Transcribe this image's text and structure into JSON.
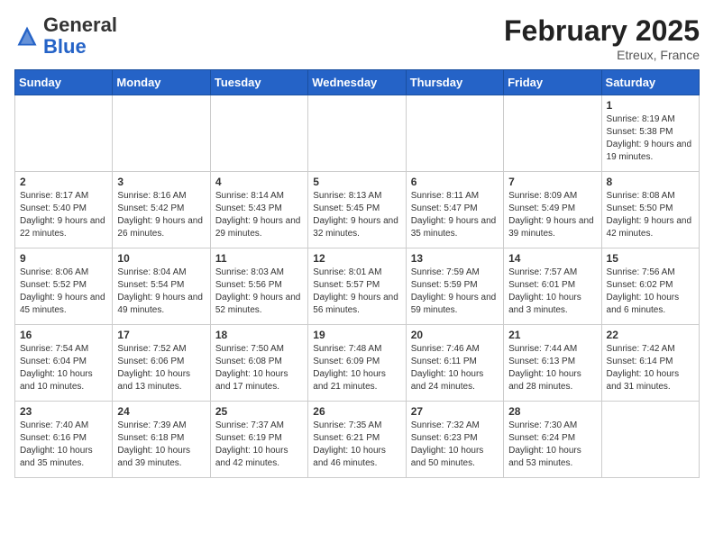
{
  "header": {
    "logo_general": "General",
    "logo_blue": "Blue",
    "month_year": "February 2025",
    "location": "Etreux, France"
  },
  "weekdays": [
    "Sunday",
    "Monday",
    "Tuesday",
    "Wednesday",
    "Thursday",
    "Friday",
    "Saturday"
  ],
  "weeks": [
    [
      {
        "day": "",
        "info": ""
      },
      {
        "day": "",
        "info": ""
      },
      {
        "day": "",
        "info": ""
      },
      {
        "day": "",
        "info": ""
      },
      {
        "day": "",
        "info": ""
      },
      {
        "day": "",
        "info": ""
      },
      {
        "day": "1",
        "info": "Sunrise: 8:19 AM\nSunset: 5:38 PM\nDaylight: 9 hours and 19 minutes."
      }
    ],
    [
      {
        "day": "2",
        "info": "Sunrise: 8:17 AM\nSunset: 5:40 PM\nDaylight: 9 hours and 22 minutes."
      },
      {
        "day": "3",
        "info": "Sunrise: 8:16 AM\nSunset: 5:42 PM\nDaylight: 9 hours and 26 minutes."
      },
      {
        "day": "4",
        "info": "Sunrise: 8:14 AM\nSunset: 5:43 PM\nDaylight: 9 hours and 29 minutes."
      },
      {
        "day": "5",
        "info": "Sunrise: 8:13 AM\nSunset: 5:45 PM\nDaylight: 9 hours and 32 minutes."
      },
      {
        "day": "6",
        "info": "Sunrise: 8:11 AM\nSunset: 5:47 PM\nDaylight: 9 hours and 35 minutes."
      },
      {
        "day": "7",
        "info": "Sunrise: 8:09 AM\nSunset: 5:49 PM\nDaylight: 9 hours and 39 minutes."
      },
      {
        "day": "8",
        "info": "Sunrise: 8:08 AM\nSunset: 5:50 PM\nDaylight: 9 hours and 42 minutes."
      }
    ],
    [
      {
        "day": "9",
        "info": "Sunrise: 8:06 AM\nSunset: 5:52 PM\nDaylight: 9 hours and 45 minutes."
      },
      {
        "day": "10",
        "info": "Sunrise: 8:04 AM\nSunset: 5:54 PM\nDaylight: 9 hours and 49 minutes."
      },
      {
        "day": "11",
        "info": "Sunrise: 8:03 AM\nSunset: 5:56 PM\nDaylight: 9 hours and 52 minutes."
      },
      {
        "day": "12",
        "info": "Sunrise: 8:01 AM\nSunset: 5:57 PM\nDaylight: 9 hours and 56 minutes."
      },
      {
        "day": "13",
        "info": "Sunrise: 7:59 AM\nSunset: 5:59 PM\nDaylight: 9 hours and 59 minutes."
      },
      {
        "day": "14",
        "info": "Sunrise: 7:57 AM\nSunset: 6:01 PM\nDaylight: 10 hours and 3 minutes."
      },
      {
        "day": "15",
        "info": "Sunrise: 7:56 AM\nSunset: 6:02 PM\nDaylight: 10 hours and 6 minutes."
      }
    ],
    [
      {
        "day": "16",
        "info": "Sunrise: 7:54 AM\nSunset: 6:04 PM\nDaylight: 10 hours and 10 minutes."
      },
      {
        "day": "17",
        "info": "Sunrise: 7:52 AM\nSunset: 6:06 PM\nDaylight: 10 hours and 13 minutes."
      },
      {
        "day": "18",
        "info": "Sunrise: 7:50 AM\nSunset: 6:08 PM\nDaylight: 10 hours and 17 minutes."
      },
      {
        "day": "19",
        "info": "Sunrise: 7:48 AM\nSunset: 6:09 PM\nDaylight: 10 hours and 21 minutes."
      },
      {
        "day": "20",
        "info": "Sunrise: 7:46 AM\nSunset: 6:11 PM\nDaylight: 10 hours and 24 minutes."
      },
      {
        "day": "21",
        "info": "Sunrise: 7:44 AM\nSunset: 6:13 PM\nDaylight: 10 hours and 28 minutes."
      },
      {
        "day": "22",
        "info": "Sunrise: 7:42 AM\nSunset: 6:14 PM\nDaylight: 10 hours and 31 minutes."
      }
    ],
    [
      {
        "day": "23",
        "info": "Sunrise: 7:40 AM\nSunset: 6:16 PM\nDaylight: 10 hours and 35 minutes."
      },
      {
        "day": "24",
        "info": "Sunrise: 7:39 AM\nSunset: 6:18 PM\nDaylight: 10 hours and 39 minutes."
      },
      {
        "day": "25",
        "info": "Sunrise: 7:37 AM\nSunset: 6:19 PM\nDaylight: 10 hours and 42 minutes."
      },
      {
        "day": "26",
        "info": "Sunrise: 7:35 AM\nSunset: 6:21 PM\nDaylight: 10 hours and 46 minutes."
      },
      {
        "day": "27",
        "info": "Sunrise: 7:32 AM\nSunset: 6:23 PM\nDaylight: 10 hours and 50 minutes."
      },
      {
        "day": "28",
        "info": "Sunrise: 7:30 AM\nSunset: 6:24 PM\nDaylight: 10 hours and 53 minutes."
      },
      {
        "day": "",
        "info": ""
      }
    ]
  ]
}
